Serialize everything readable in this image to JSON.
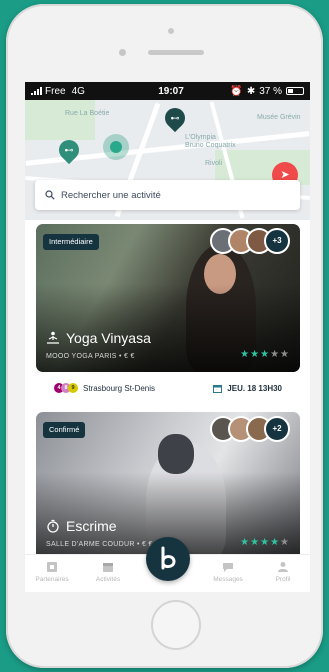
{
  "statusbar": {
    "carrier": "Free",
    "network": "4G",
    "time": "19:07",
    "battery": "37 %",
    "battery_level": 0.37
  },
  "map": {
    "labels": [
      "Rue La Boétie",
      "L'Olympia",
      "Bruno Coquatrix",
      "Musée Grévin",
      "Rivoli"
    ],
    "pin_icon": "dumbbell-icon",
    "locate_icon": "navigation-arrow-icon"
  },
  "search": {
    "placeholder": "Rechercher une activité",
    "icon": "search-icon"
  },
  "cards": [
    {
      "level": "Intermédiaire",
      "title": "Yoga Vinyasa",
      "icon": "yoga-icon",
      "studio": "MOOO YOGA PARIS",
      "price": "€ €",
      "rating": 3,
      "rating_max": 5,
      "extra_participants": "+3",
      "location": "Strasbourg St-Denis",
      "metro_lines": [
        "4",
        "8",
        "9"
      ],
      "date": "JEU. 18 13H30",
      "colors": {
        "line4": "#a0006e",
        "line8": "#d282be",
        "line9": "#d5c900"
      }
    },
    {
      "level": "Confirmé",
      "title": "Escrime",
      "icon": "stopwatch-icon",
      "studio": "SALLE D'ARME COUDUR",
      "price": "€ €",
      "rating": 4,
      "rating_max": 5,
      "extra_participants": "+2"
    }
  ],
  "tabs": [
    {
      "label": "Partenaires",
      "icon": "partners-icon"
    },
    {
      "label": "Activités",
      "icon": "calendar-icon"
    },
    {
      "label": "",
      "icon": "brand-logo-icon"
    },
    {
      "label": "Messages",
      "icon": "chat-icon"
    },
    {
      "label": "Profil",
      "icon": "user-icon"
    }
  ],
  "colors": {
    "background": "#1a9c86",
    "accent": "#2fc3a0",
    "navy": "#16343f",
    "locate": "#f04a4a"
  }
}
